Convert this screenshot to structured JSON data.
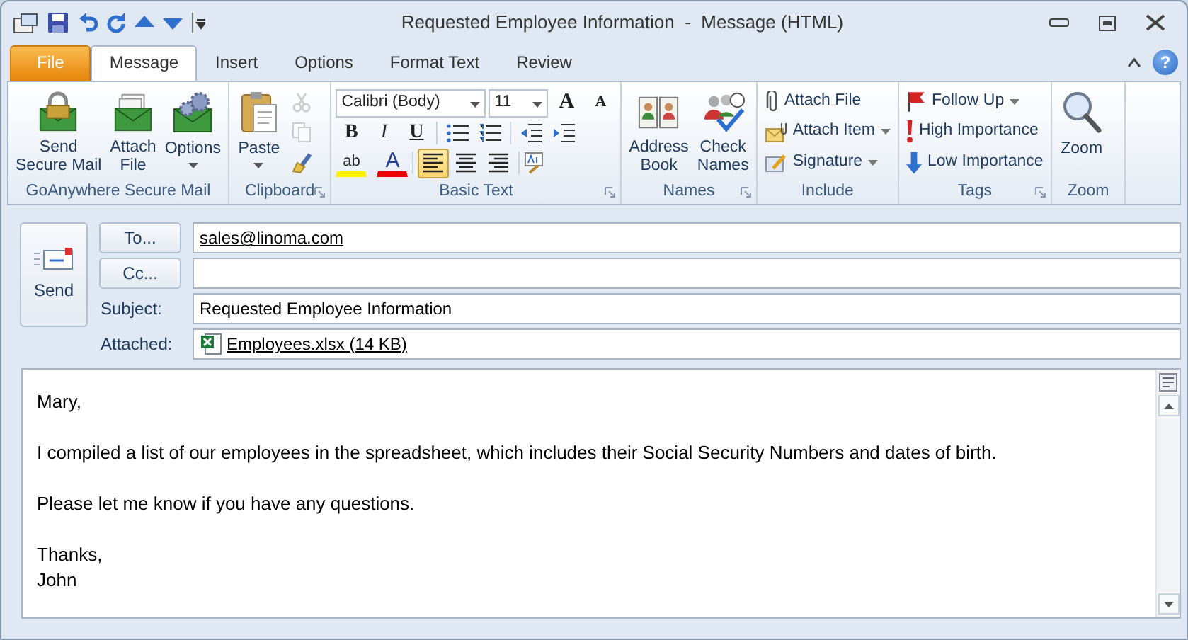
{
  "window": {
    "title": "Requested Employee Information  -  Message (HTML)",
    "help": "?"
  },
  "tabs": [
    {
      "label": "File",
      "kind": "file",
      "selected": false
    },
    {
      "label": "Message",
      "kind": "tab",
      "selected": true
    },
    {
      "label": "Insert",
      "kind": "tab",
      "selected": false
    },
    {
      "label": "Options",
      "kind": "tab",
      "selected": false
    },
    {
      "label": "Format Text",
      "kind": "tab",
      "selected": false
    },
    {
      "label": "Review",
      "kind": "tab",
      "selected": false
    }
  ],
  "ribbon": {
    "groups": [
      {
        "label": "GoAnywhere Secure Mail",
        "launcher": false,
        "items": [
          {
            "kind": "large",
            "label": "Send Secure Mail",
            "dropdown": false
          },
          {
            "kind": "large",
            "label": "Attach File",
            "dropdown": false
          },
          {
            "kind": "large",
            "label": "Options",
            "dropdown": true
          }
        ]
      },
      {
        "label": "Clipboard",
        "launcher": true,
        "items": [
          {
            "kind": "large",
            "label": "Paste",
            "dropdown": true
          },
          {
            "kind": "stack",
            "items": [
              {
                "disabled": true
              },
              {
                "disabled": true
              },
              {
                "disabled": false
              }
            ]
          }
        ]
      },
      {
        "label": "Basic Text",
        "launcher": true,
        "items": [
          {
            "kind": "basic-text",
            "font": "Calibri (Body)",
            "size": "11",
            "grow": "A",
            "shrink": "A",
            "styles": [
              "B",
              "I",
              "U"
            ],
            "highlight": "ab",
            "color_letter": "A",
            "align": [
              {
                "selected": true
              },
              {
                "selected": false
              },
              {
                "selected": false
              }
            ]
          }
        ]
      },
      {
        "label": "Names",
        "launcher": true,
        "items": [
          {
            "kind": "large",
            "label": "Address Book",
            "dropdown": false
          },
          {
            "kind": "large",
            "label": "Check Names",
            "dropdown": false
          }
        ]
      },
      {
        "label": "Include",
        "launcher": false,
        "items": [
          {
            "kind": "small-list",
            "items": [
              {
                "label": "Attach File",
                "dropdown": false
              },
              {
                "label": "Attach Item",
                "dropdown": true
              },
              {
                "label": "Signature",
                "dropdown": true
              }
            ]
          }
        ]
      },
      {
        "label": "Tags",
        "launcher": true,
        "items": [
          {
            "kind": "small-list",
            "items": [
              {
                "label": "Follow Up",
                "dropdown": true
              },
              {
                "label": "High Importance",
                "dropdown": false
              },
              {
                "label": "Low Importance",
                "dropdown": false
              }
            ]
          }
        ]
      },
      {
        "label": "Zoom",
        "launcher": false,
        "items": [
          {
            "kind": "large",
            "label": "Zoom",
            "dropdown": false
          }
        ]
      }
    ]
  },
  "send_button": {
    "label": "Send"
  },
  "header": {
    "to_button": "To...",
    "to_value": "sales@linoma.com",
    "cc_button": "Cc...",
    "subject_label": "Subject:",
    "subject_value": "Requested Employee Information",
    "attached_label": "Attached:",
    "attachment": "Employees.xlsx (14 KB)"
  },
  "body": {
    "paragraphs": [
      [
        "Mary,"
      ],
      [
        "I compiled a list of our employees in the spreadsheet, which includes their Social Security Numbers and dates of birth."
      ],
      [
        "Please let me know if you have any questions."
      ],
      [
        "Thanks,",
        "John"
      ]
    ]
  }
}
